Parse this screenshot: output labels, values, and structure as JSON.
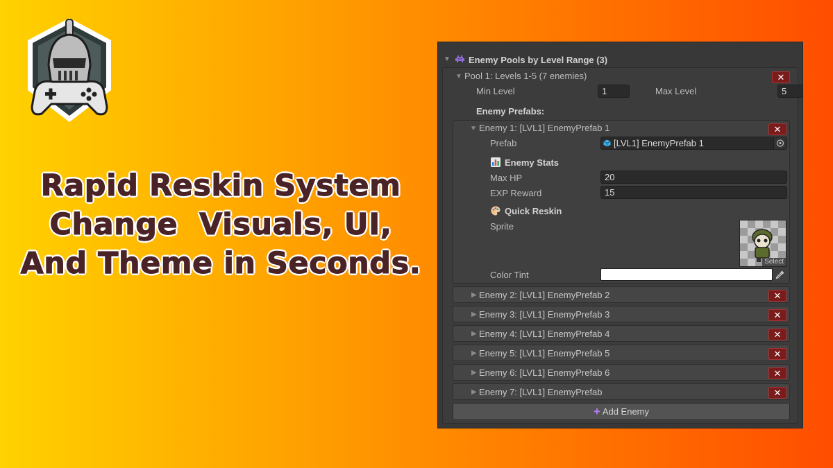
{
  "headline": {
    "lines": [
      "Rapid Reskin System",
      "Change  Visuals, UI,",
      "And Theme in Seconds."
    ],
    "color": "#4a2327"
  },
  "inspector": {
    "header_label": "Enemy Pools by Level Range (3)",
    "pool": {
      "title": "Pool 1: Levels 1-5 (7 enemies)",
      "min_level_label": "Min Level",
      "min_level_value": "1",
      "max_level_label": "Max Level",
      "max_level_value": "5",
      "prefabs_label": "Enemy Prefabs:",
      "enemy_expanded": {
        "title": "Enemy 1: [LVL1] EnemyPrefab 1",
        "prefab_label": "Prefab",
        "prefab_value": "[LVL1] EnemyPrefab 1",
        "stats_label": "Enemy Stats",
        "max_hp_label": "Max HP",
        "max_hp_value": "20",
        "exp_reward_label": "EXP Reward",
        "exp_reward_value": "15",
        "reskin_label": "Quick Reskin",
        "sprite_label": "Sprite",
        "sprite_select_label": "Select",
        "color_tint_label": "Color Tint",
        "color_tint_value": "#ffffff"
      },
      "enemies_collapsed": [
        "Enemy 2: [LVL1] EnemyPrefab 2",
        "Enemy 3: [LVL1] EnemyPrefab 3",
        "Enemy 4: [LVL1] EnemyPrefab 4",
        "Enemy 5: [LVL1] EnemyPrefab 5",
        "Enemy 6: [LVL1] EnemyPrefab 6",
        "Enemy 7: [LVL1] EnemyPrefab"
      ],
      "add_enemy_label": "Add Enemy"
    }
  },
  "icons": {
    "remove": "close-icon",
    "prefab": "cube-icon",
    "stats": "bar-chart-icon",
    "reskin": "palette-icon",
    "picker": "object-picker-icon",
    "eyedropper": "eyedropper-icon",
    "add": "plus-icon"
  },
  "colors": {
    "panel_bg": "#383838",
    "remove_button": "#7a1c1c",
    "add_plus": "#b57cf0"
  }
}
